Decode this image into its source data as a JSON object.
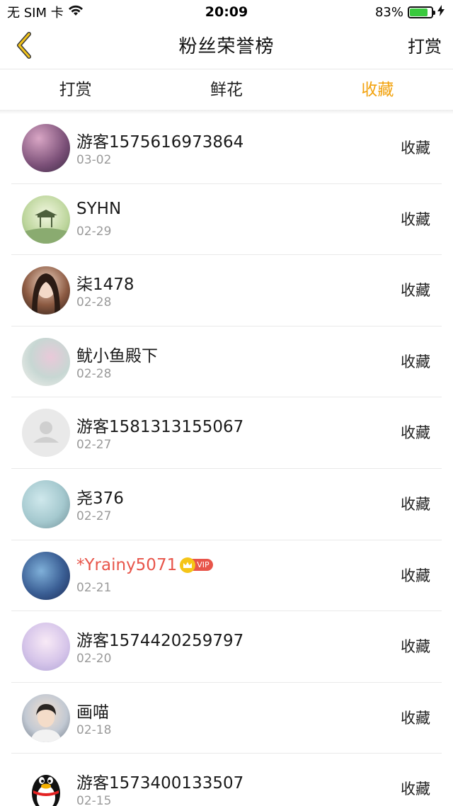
{
  "status_bar": {
    "carrier": "无 SIM 卡",
    "time": "20:09",
    "battery_percent": "83%",
    "battery_level": 0.83,
    "wifi_icon": "wifi-icon",
    "charging_icon": "charging-bolt-icon"
  },
  "nav": {
    "back_icon": "chevron-left-icon",
    "title": "粉丝荣誉榜",
    "action_label": "打赏"
  },
  "tabs": [
    {
      "label": "打赏",
      "active": false
    },
    {
      "label": "鲜花",
      "active": false
    },
    {
      "label": "收藏",
      "active": true
    }
  ],
  "colors": {
    "accent": "#f2a20d",
    "vip_name": "#e8554a",
    "date_text": "#9a9a9a",
    "divider": "#e9e9e9"
  },
  "list": [
    {
      "name": "游客1575616973864",
      "date": "03-02",
      "action": "收藏",
      "vip": false
    },
    {
      "name": "SYHN",
      "date": "02-29",
      "action": "收藏",
      "vip": false
    },
    {
      "name": "柒1478",
      "date": "02-28",
      "action": "收藏",
      "vip": false
    },
    {
      "name": "鱿小鱼殿下",
      "date": "02-28",
      "action": "收藏",
      "vip": false
    },
    {
      "name": "游客1581313155067",
      "date": "02-27",
      "action": "收藏",
      "vip": false,
      "avatar_placeholder": true
    },
    {
      "name": "尧376",
      "date": "02-27",
      "action": "收藏",
      "vip": false
    },
    {
      "name": "*Yrainy5071",
      "date": "02-21",
      "action": "收藏",
      "vip": true,
      "badge_text": "VIP"
    },
    {
      "name": "游客1574420259797",
      "date": "02-20",
      "action": "收藏",
      "vip": false
    },
    {
      "name": "画喵",
      "date": "02-18",
      "action": "收藏",
      "vip": false
    },
    {
      "name": "游客1573400133507",
      "date": "02-15",
      "action": "收藏",
      "vip": false,
      "avatar_icon": "qq-penguin-icon"
    }
  ]
}
